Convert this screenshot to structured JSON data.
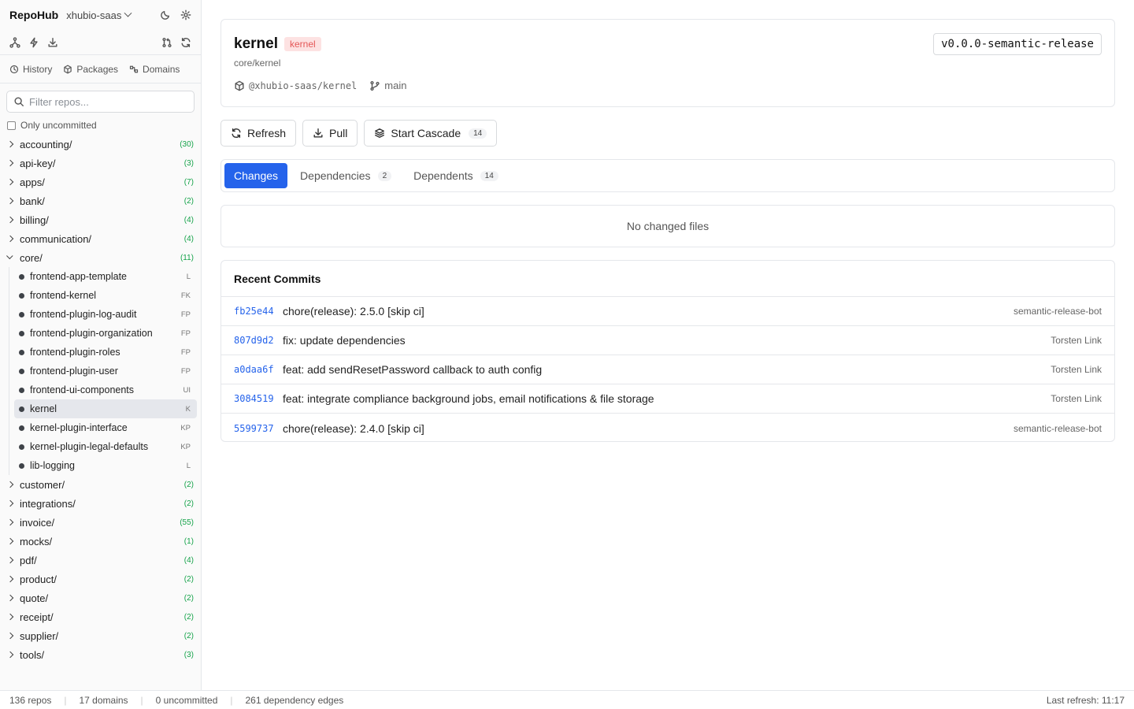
{
  "app": {
    "title": "RepoHub",
    "org": "xhubio-saas"
  },
  "sidebar": {
    "tabs": [
      {
        "label": "History",
        "icon": "clock-icon"
      },
      {
        "label": "Packages",
        "icon": "package-icon"
      },
      {
        "label": "Domains",
        "icon": "domains-icon"
      }
    ],
    "filter_placeholder": "Filter repos...",
    "only_uncommitted_label": "Only uncommitted",
    "groups": [
      {
        "name": "accounting/",
        "count": "(30)"
      },
      {
        "name": "api-key/",
        "count": "(3)"
      },
      {
        "name": "apps/",
        "count": "(7)"
      },
      {
        "name": "bank/",
        "count": "(2)"
      },
      {
        "name": "billing/",
        "count": "(4)"
      },
      {
        "name": "communication/",
        "count": "(4)"
      },
      {
        "name": "core/",
        "count": "(11)"
      },
      {
        "name": "customer/",
        "count": "(2)"
      },
      {
        "name": "integrations/",
        "count": "(2)"
      },
      {
        "name": "invoice/",
        "count": "(55)"
      },
      {
        "name": "mocks/",
        "count": "(1)"
      },
      {
        "name": "pdf/",
        "count": "(4)"
      },
      {
        "name": "product/",
        "count": "(2)"
      },
      {
        "name": "quote/",
        "count": "(2)"
      },
      {
        "name": "receipt/",
        "count": "(2)"
      },
      {
        "name": "supplier/",
        "count": "(2)"
      },
      {
        "name": "tools/",
        "count": "(3)"
      }
    ],
    "core_children": [
      {
        "name": "frontend-app-template",
        "abbr": "L"
      },
      {
        "name": "frontend-kernel",
        "abbr": "FK"
      },
      {
        "name": "frontend-plugin-log-audit",
        "abbr": "FP"
      },
      {
        "name": "frontend-plugin-organization",
        "abbr": "FP"
      },
      {
        "name": "frontend-plugin-roles",
        "abbr": "FP"
      },
      {
        "name": "frontend-plugin-user",
        "abbr": "FP"
      },
      {
        "name": "frontend-ui-components",
        "abbr": "UI"
      },
      {
        "name": "kernel",
        "abbr": "K"
      },
      {
        "name": "kernel-plugin-interface",
        "abbr": "KP"
      },
      {
        "name": "kernel-plugin-legal-defaults",
        "abbr": "KP"
      },
      {
        "name": "lib-logging",
        "abbr": "L"
      }
    ]
  },
  "repo": {
    "name": "kernel",
    "badge": "kernel",
    "path": "core/kernel",
    "package": "@xhubio-saas/kernel",
    "branch": "main",
    "version": "v0.0.0-semantic-release"
  },
  "actions": {
    "refresh": "Refresh",
    "pull": "Pull",
    "cascade": "Start Cascade",
    "cascade_count": "14"
  },
  "tabs": {
    "changes": "Changes",
    "dependencies": "Dependencies",
    "dependencies_count": "2",
    "dependents": "Dependents",
    "dependents_count": "14"
  },
  "changes": {
    "empty": "No changed files"
  },
  "commits": {
    "title": "Recent Commits",
    "items": [
      {
        "sha": "fb25e44",
        "message": "chore(release): 2.5.0 [skip ci]",
        "author": "semantic-release-bot"
      },
      {
        "sha": "807d9d2",
        "message": "fix: update dependencies",
        "author": "Torsten Link"
      },
      {
        "sha": "a0daa6f",
        "message": "feat: add sendResetPassword callback to auth config",
        "author": "Torsten Link"
      },
      {
        "sha": "3084519",
        "message": "feat: integrate compliance background jobs, email notifications & file storage",
        "author": "Torsten Link"
      },
      {
        "sha": "5599737",
        "message": "chore(release): 2.4.0 [skip ci]",
        "author": "semantic-release-bot"
      }
    ]
  },
  "footer": {
    "repos": "136 repos",
    "domains": "17 domains",
    "uncommitted": "0 uncommitted",
    "edges": "261 dependency edges",
    "last_refresh": "Last refresh: 11:17"
  },
  "colors": {
    "accent": "#2563eb",
    "badge_bg": "#fde2e2",
    "badge_text": "#e45757",
    "count": "#16a34a"
  }
}
